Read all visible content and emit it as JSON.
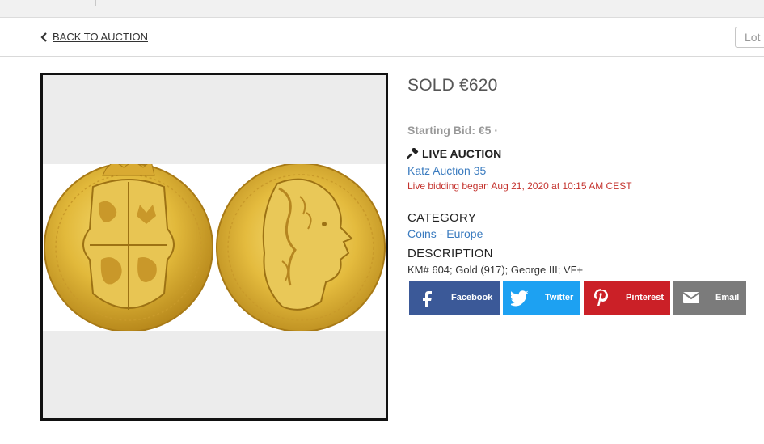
{
  "header": {
    "back_label": "BACK TO AUCTION",
    "lot_label": "Lot"
  },
  "lot": {
    "status_price": "SOLD €620",
    "starting_bid": "Starting Bid: €5 ·",
    "live_label": "LIVE AUCTION",
    "auction_name": "Katz Auction 35",
    "live_began": "Live bidding began Aug 21, 2020 at 10:15 AM CEST",
    "category_heading": "CATEGORY",
    "category_value": "Coins - Europe",
    "description_heading": "DESCRIPTION",
    "description_value": "KM# 604; Gold (917); George III; VF+"
  },
  "share": {
    "facebook": "Facebook",
    "twitter": "Twitter",
    "pinterest": "Pinterest",
    "email": "Email"
  },
  "colors": {
    "link": "#3a7bbf",
    "alert": "#c4322d",
    "facebook": "#3b5998",
    "twitter": "#1da1f2",
    "pinterest": "#cb2027",
    "email": "#7b7b7b",
    "gold": "#e2b93b"
  },
  "icons": [
    "chevron-left-icon",
    "gavel-icon",
    "facebook-icon",
    "twitter-icon",
    "pinterest-icon",
    "email-icon"
  ]
}
